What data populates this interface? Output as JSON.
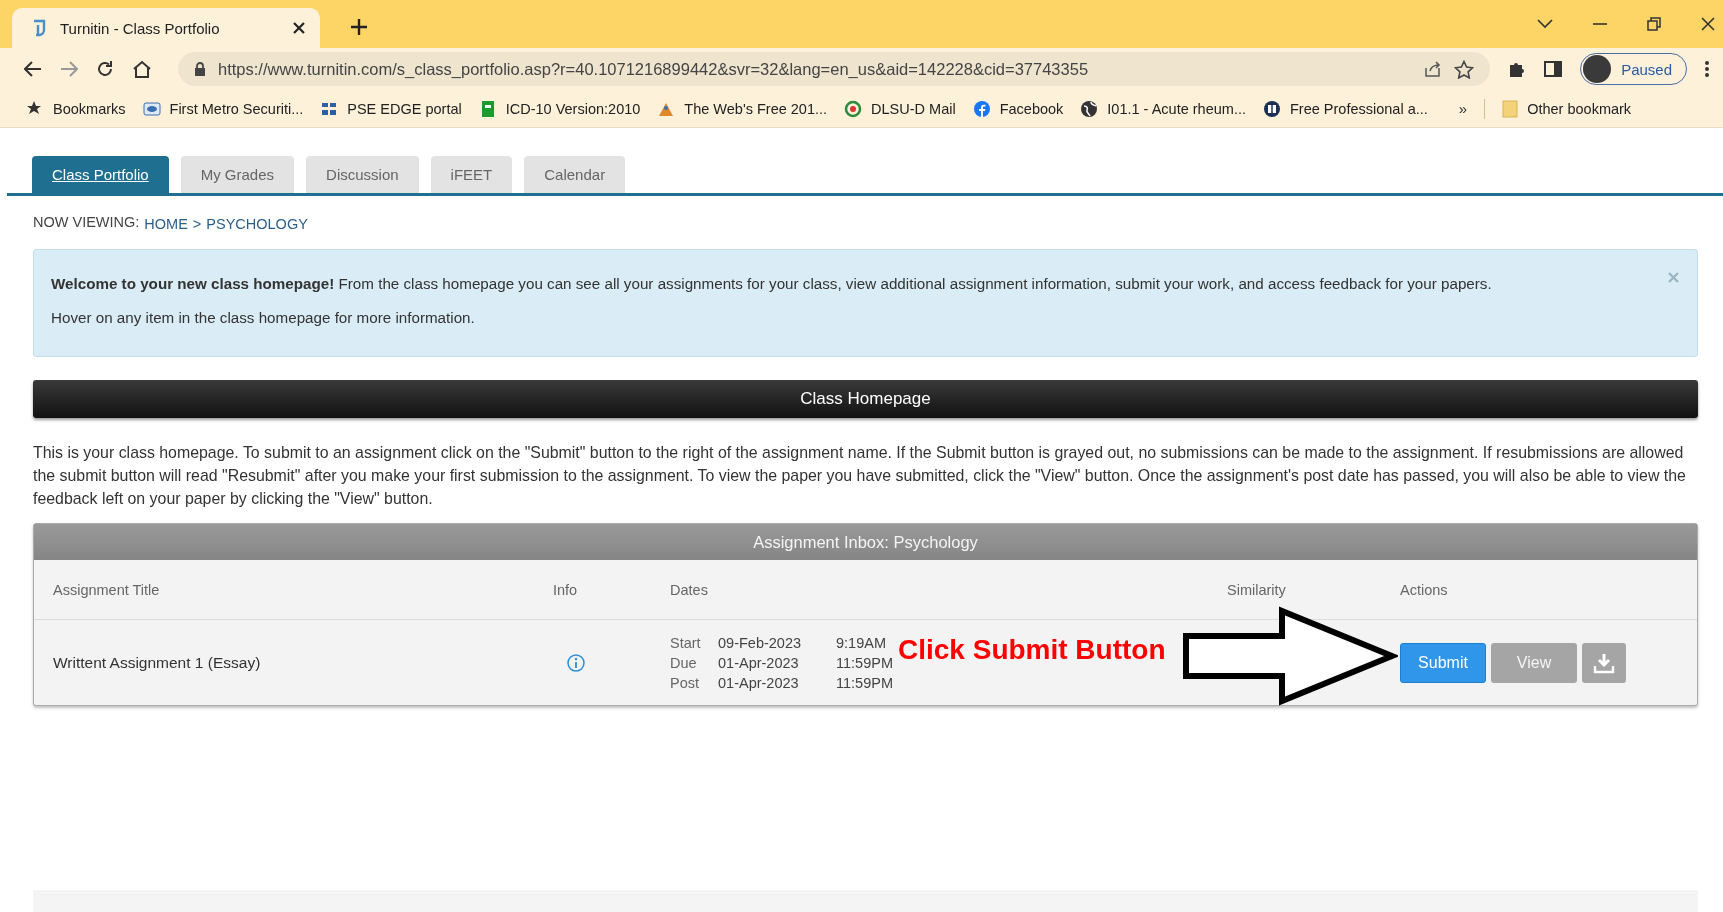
{
  "browser": {
    "tab_title": "Turnitin - Class Portfolio",
    "url": "https://www.turnitin.com/s_class_portfolio.asp?r=40.1071216899442&svr=32&lang=en_us&aid=142228&cid=37743355",
    "profile_status": "Paused",
    "bookmarks": [
      "Bookmarks",
      "First Metro Securiti...",
      "PSE EDGE portal",
      "ICD-10 Version:2010",
      "The Web's Free 201...",
      "DLSU-D Mail",
      "Facebook",
      "I01.1 - Acute rheum...",
      "Free Professional a..."
    ],
    "overflow": "»",
    "other_bookmarks": "Other bookmark"
  },
  "nav_tabs": [
    {
      "label": "Class Portfolio",
      "selected": true
    },
    {
      "label": "My Grades",
      "selected": false
    },
    {
      "label": "Discussion",
      "selected": false
    },
    {
      "label": "iFEET",
      "selected": false
    },
    {
      "label": "Calendar",
      "selected": false
    }
  ],
  "breadcrumb": {
    "label": "NOW VIEWING:",
    "items": [
      "HOME",
      "PSYCHOLOGY"
    ],
    "separator": ">"
  },
  "notice": {
    "text": "**Welcome to your new class homepage!** From the class homepage you can see all your assignments for your class, view additional assignment information, submit your work, and access feedback for your papers.",
    "second_line": "Hover on any item in the class homepage for more information."
  },
  "section_title": "Class Homepage",
  "description": "This is your class homepage. To submit to an assignment click on the \"Submit\" button to the right of the assignment name. If the Submit button is grayed out, no submissions can be made to the assignment. If resubmissions are allowed the submit button will read \"Resubmit\" after you make your first submission to the assignment. To view the paper you have submitted, click the \"View\" button. Once the assignment's post date has passed, you will also be able to view the feedback left on your paper by clicking the \"View\" button.",
  "inbox": {
    "title": "Assignment Inbox: Psychology",
    "columns": [
      "Assignment Title",
      "Info",
      "Dates",
      "Similarity",
      "Actions"
    ],
    "rows": [
      {
        "title": "Writtent Assignment 1 (Essay)",
        "dates": [
          {
            "label": "Start",
            "date": "09-Feb-2023",
            "time": "9:19AM"
          },
          {
            "label": "Due",
            "date": "01-Apr-2023",
            "time": "11:59PM"
          },
          {
            "label": "Post",
            "date": "01-Apr-2023",
            "time": "11:59PM"
          }
        ],
        "actions": [
          {
            "kind": "primary",
            "label": "Submit"
          },
          {
            "kind": "secondary",
            "label": "View"
          },
          {
            "kind": "download"
          }
        ]
      }
    ]
  },
  "callout": {
    "text": "Click Submit Button"
  }
}
